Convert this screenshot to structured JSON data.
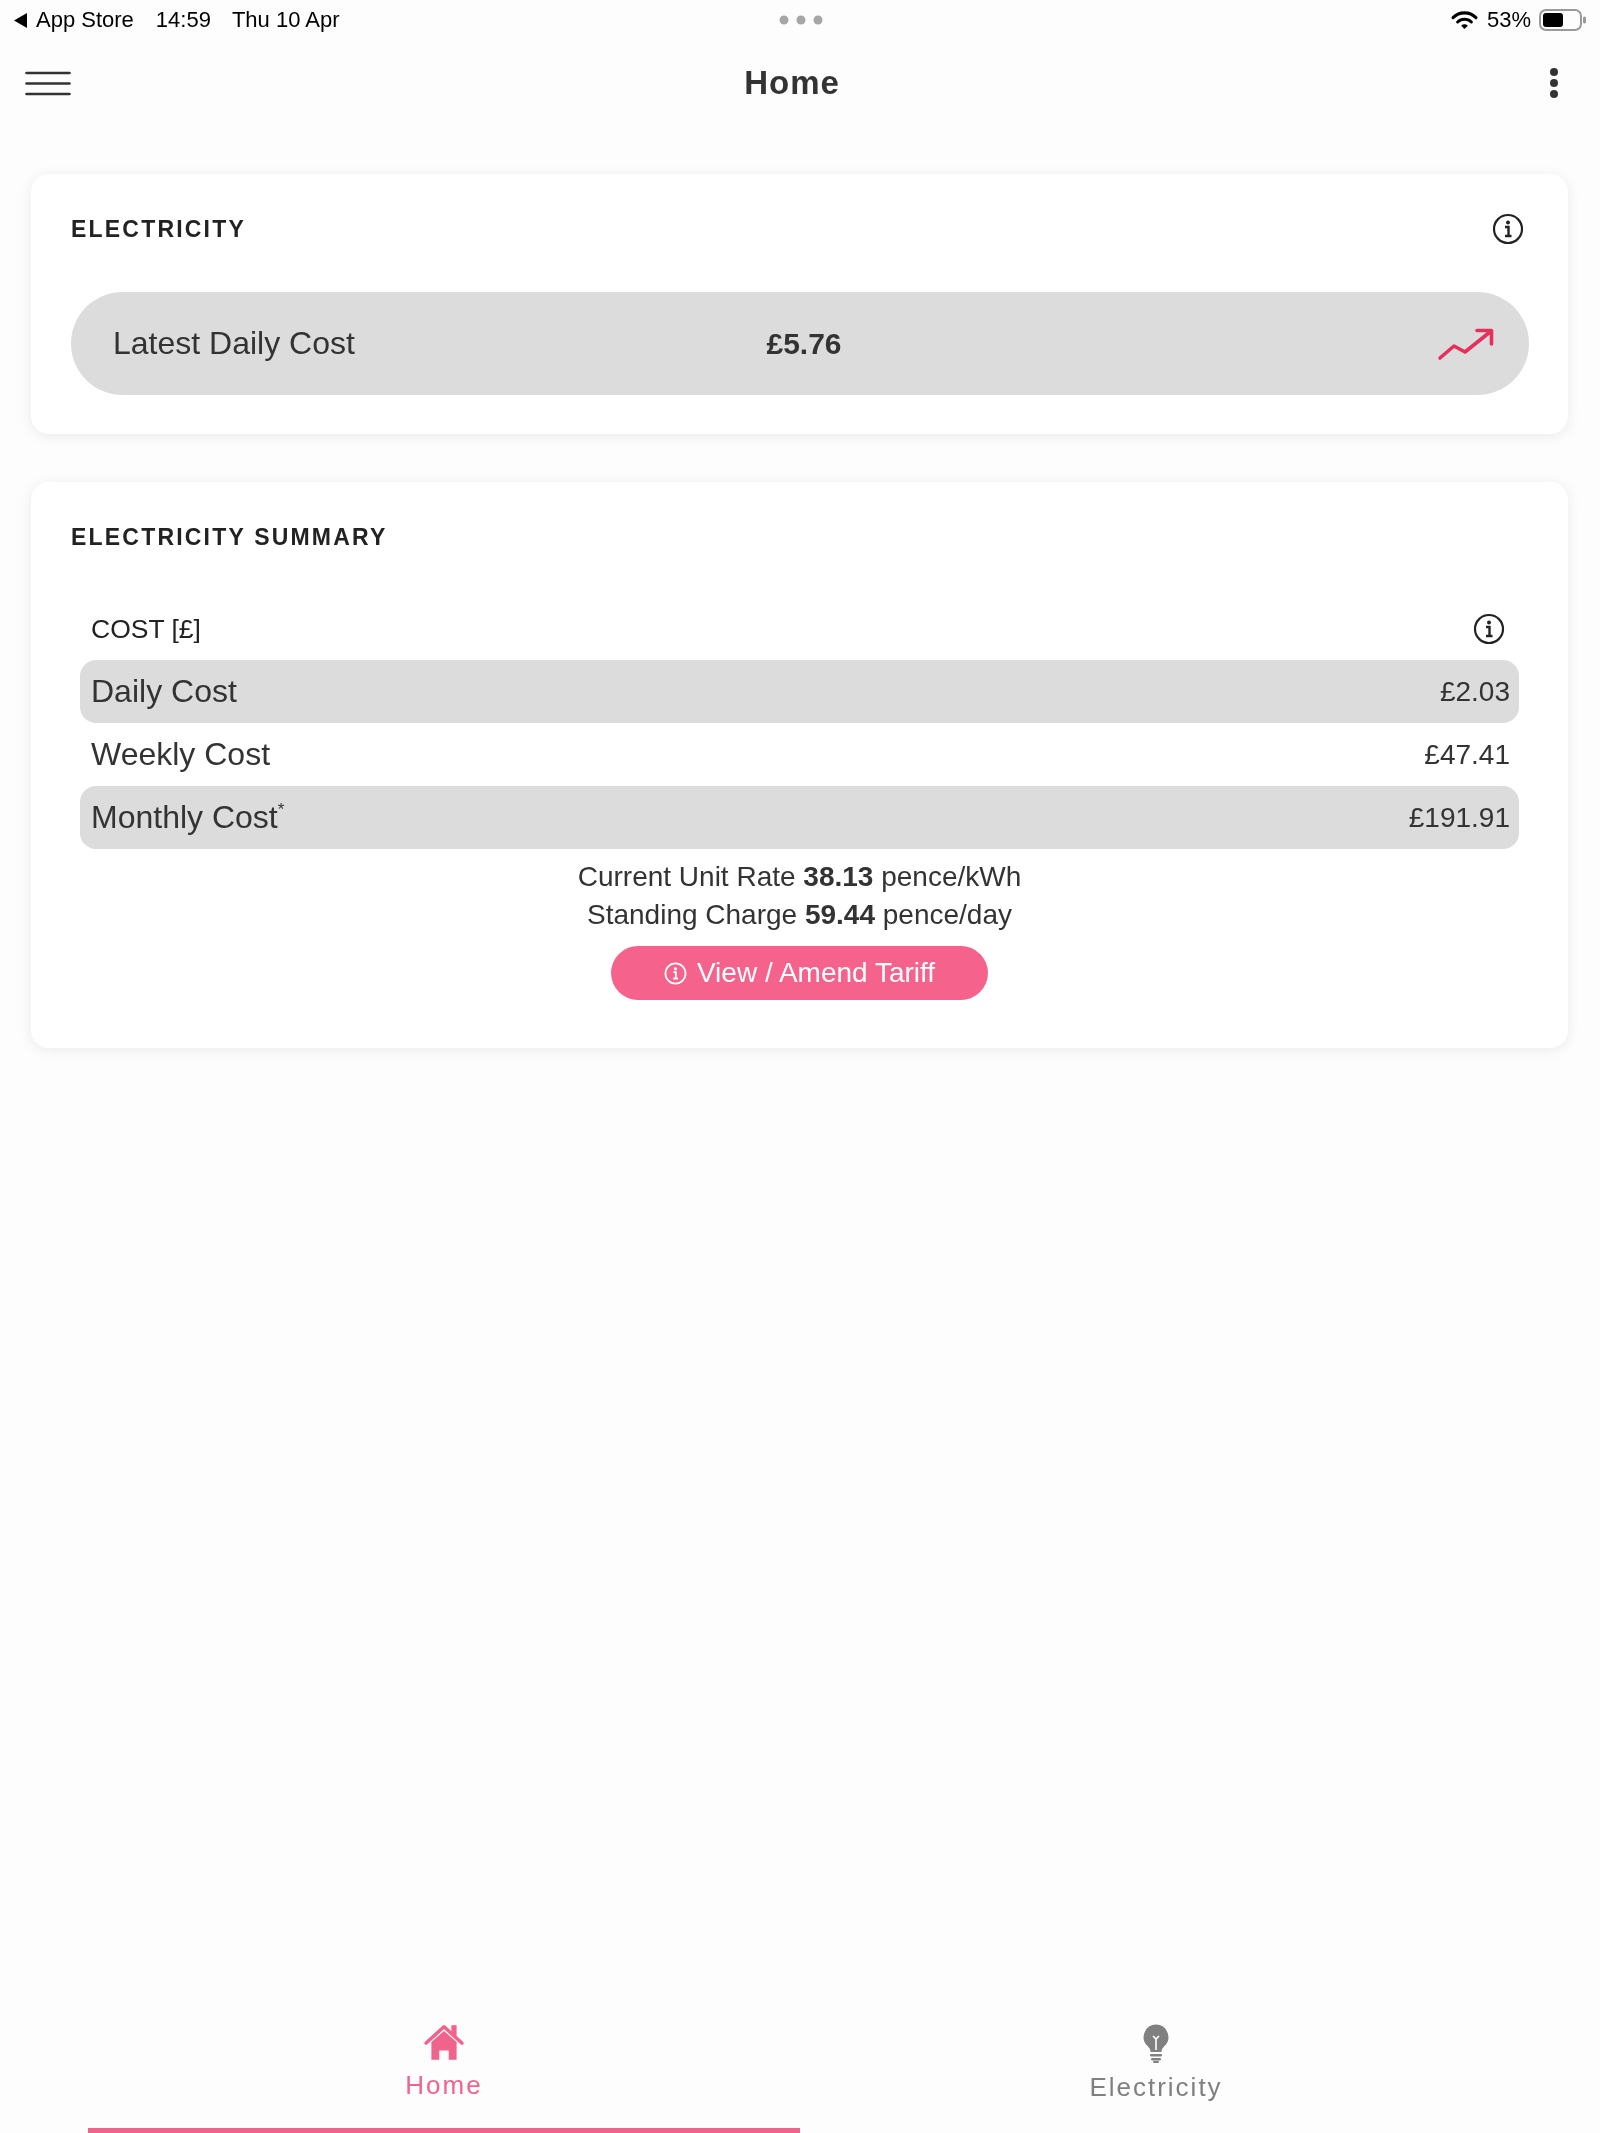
{
  "status_bar": {
    "back_label": "App Store",
    "time": "14:59",
    "date": "Thu 10 Apr",
    "battery": "53%"
  },
  "header": {
    "title": "Home"
  },
  "electricity": {
    "title": "ELECTRICITY",
    "latest": {
      "label": "Latest Daily Cost",
      "value": "£5.76"
    }
  },
  "summary": {
    "title": "ELECTRICITY SUMMARY",
    "heading": "COST [£]",
    "rows": [
      {
        "label": "Daily Cost",
        "value": "£2.03"
      },
      {
        "label": "Weekly Cost",
        "value": "£47.41"
      },
      {
        "label": "Monthly Cost$^{*}$",
        "value": "£191.91"
      }
    ],
    "rates": [
      "Current Unit Rate **38.13** pence/kWh",
      "Standing Charge **59.44** pence/day"
    ],
    "button": "View / Amend Tariff"
  },
  "tabs": [
    {
      "kind": "home",
      "label": "Home",
      "selected": true
    },
    {
      "kind": "electricity",
      "label": "Electricity",
      "selected": false
    }
  ]
}
